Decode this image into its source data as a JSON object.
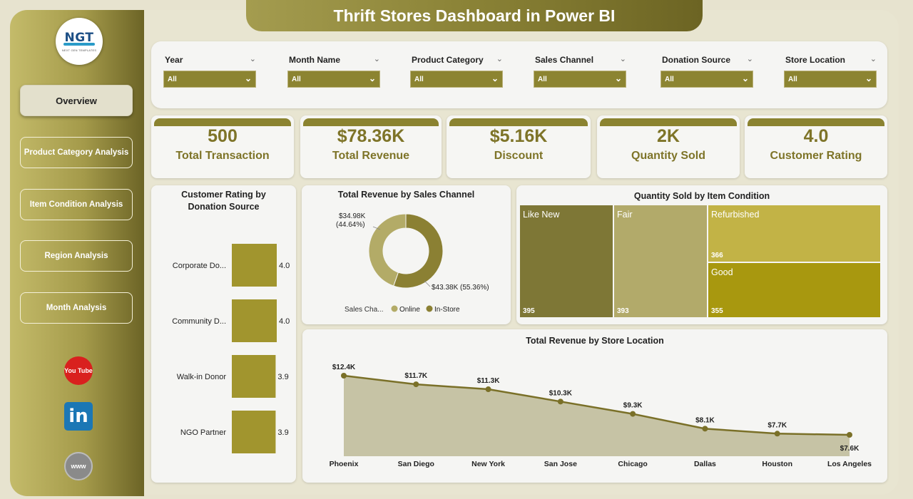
{
  "app": {
    "title": "Thrift Stores Dashboard in Power BI",
    "logo_text": "NGT",
    "logo_subtext": "NEXT GEN TEMPLATES"
  },
  "nav": [
    {
      "label": "Overview",
      "active": true
    },
    {
      "label": "Product Category Analysis",
      "active": false
    },
    {
      "label": "Item Condition Analysis",
      "active": false
    },
    {
      "label": "Region Analysis",
      "active": false
    },
    {
      "label": "Month Analysis",
      "active": false
    }
  ],
  "social": {
    "youtube": "You Tube",
    "linkedin": "in",
    "web": "www"
  },
  "filters": [
    {
      "label": "Year",
      "value": "All"
    },
    {
      "label": "Month Name",
      "value": "All"
    },
    {
      "label": "Product Category",
      "value": "All"
    },
    {
      "label": "Sales Channel",
      "value": "All"
    },
    {
      "label": "Donation Source",
      "value": "All"
    },
    {
      "label": "Store Location",
      "value": "All"
    }
  ],
  "kpis": [
    {
      "value": "500",
      "label": "Total Transaction"
    },
    {
      "value": "$78.36K",
      "label": "Total Revenue"
    },
    {
      "value": "$5.16K",
      "label": "Discount"
    },
    {
      "value": "2K",
      "label": "Quantity Sold"
    },
    {
      "value": "4.0",
      "label": "Customer Rating"
    }
  ],
  "colors": {
    "accent": "#8b8330",
    "bar": "#a1952e",
    "online": "#b3ab67",
    "instore": "#8b8033",
    "area": "#c6c3a5",
    "line": "#7a7028"
  },
  "chart_data": [
    {
      "type": "bar",
      "title": "Customer Rating by Donation Source",
      "categories": [
        "Corporate Do...",
        "Community D...",
        "Walk-in Donor",
        "NGO Partner"
      ],
      "values": [
        4.0,
        4.0,
        3.9,
        3.9
      ],
      "value_labels": [
        "4.0",
        "4.0",
        "3.9",
        "3.9"
      ]
    },
    {
      "type": "pie",
      "title": "Total Revenue by Sales Channel",
      "legend_title": "Sales Cha...",
      "slices": [
        {
          "name": "Online",
          "value": 34.98,
          "label": "$34.98K",
          "percent_label": "(44.64%)"
        },
        {
          "name": "In-Store",
          "value": 43.38,
          "label": "$43.38K (55.36%)"
        }
      ]
    },
    {
      "type": "heatmap",
      "title": "Quantity Sold by Item Condition",
      "items": [
        {
          "name": "Like New",
          "value": 395
        },
        {
          "name": "Fair",
          "value": 393
        },
        {
          "name": "Refurbished",
          "value": 366
        },
        {
          "name": "Good",
          "value": 355
        }
      ]
    },
    {
      "type": "area",
      "title": "Total Revenue by Store Location",
      "categories": [
        "Phoenix",
        "San Diego",
        "New York",
        "San Jose",
        "Chicago",
        "Dallas",
        "Houston",
        "Los Angeles"
      ],
      "values": [
        12.4,
        11.7,
        11.3,
        10.3,
        9.3,
        8.1,
        7.7,
        7.6
      ],
      "value_labels": [
        "$12.4K",
        "$11.7K",
        "$11.3K",
        "$10.3K",
        "$9.3K",
        "$8.1K",
        "$7.7K",
        "$7.6K"
      ]
    }
  ]
}
